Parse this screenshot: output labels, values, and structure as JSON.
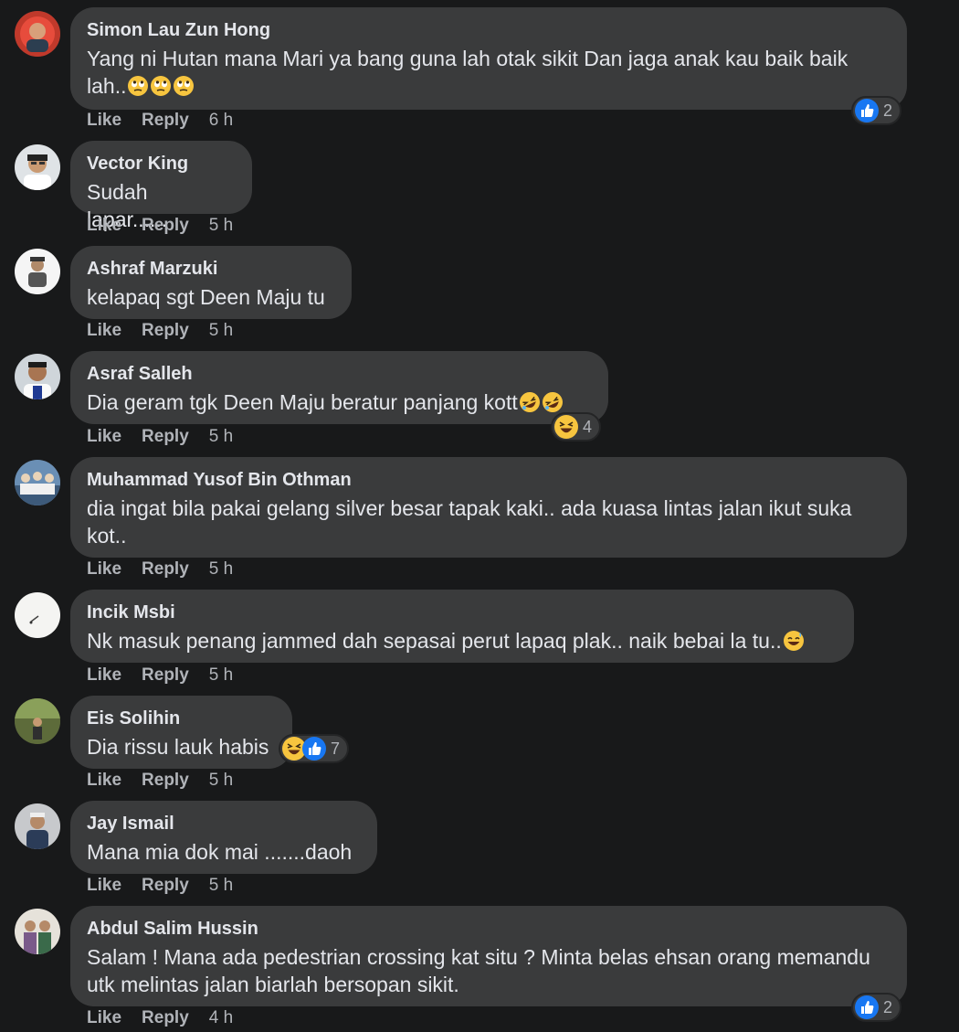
{
  "actions": {
    "like": "Like",
    "reply": "Reply"
  },
  "colors": {
    "background": "#18191a",
    "bubble": "#3a3b3c",
    "like_blue": "#1877f2",
    "haha_yellow": "#f7c53f"
  },
  "comments": [
    {
      "author": "Simon Lau Zun Hong",
      "text": "Yang ni Hutan mana Mari ya bang guna lah otak sikit Dan jaga anak kau baik baik lah..",
      "emojis": [
        "rolling-eyes-emoji",
        "rolling-eyes-emoji",
        "rolling-eyes-emoji"
      ],
      "time": "6 h",
      "reactions": [
        "like-reaction"
      ],
      "reaction_count": "2"
    },
    {
      "author": "Vector King",
      "text": "Sudah lapar......",
      "time": "5 h"
    },
    {
      "author": "Ashraf Marzuki",
      "text": "kelapaq sgt Deen Maju tu",
      "time": "5 h"
    },
    {
      "author": "Asraf Salleh",
      "text": "Dia geram tgk Deen Maju beratur panjang kott",
      "emojis": [
        "rofl-emoji",
        "rofl-emoji"
      ],
      "time": "5 h",
      "reactions": [
        "haha-reaction"
      ],
      "reaction_count": "4"
    },
    {
      "author": "Muhammad Yusof Bin Othman",
      "text": "dia ingat bila pakai gelang silver besar tapak kaki.. ada kuasa lintas jalan ikut suka kot..",
      "time": "5 h"
    },
    {
      "author": "Incik Msbi",
      "text": "Nk masuk penang jammed dah sepasai perut lapaq plak.. naik bebai la tu..",
      "emojis": [
        "sweat-smile-emoji"
      ],
      "time": "5 h"
    },
    {
      "author": "Eis Solihin",
      "text": "Dia rissu lauk habis",
      "time": "5 h",
      "reactions": [
        "haha-reaction",
        "like-reaction"
      ],
      "reaction_count": "7"
    },
    {
      "author": "Jay Ismail",
      "text": "Mana mia dok mai .......daoh",
      "time": "5 h"
    },
    {
      "author": "Abdul Salim Hussin",
      "text": "Salam ! Mana ada pedestrian crossing kat situ ? Minta belas ehsan orang memandu utk melintas jalan biarlah bersopan sikit.",
      "time": "4 h",
      "reactions": [
        "like-reaction"
      ],
      "reaction_count": "2"
    }
  ]
}
